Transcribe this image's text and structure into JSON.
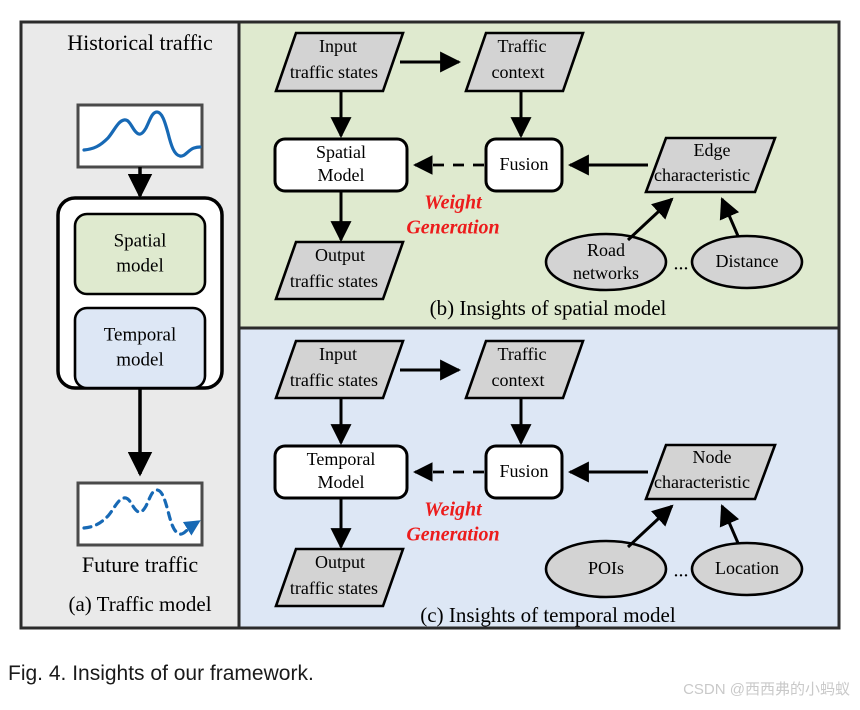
{
  "figure": {
    "caption": "Fig. 4. Insights of our framework.",
    "watermark": "CSDN @西西弗的小蚂蚁"
  },
  "colors": {
    "panel_a_bg": "#eaeaea",
    "panel_b_bg": "#dfeacf",
    "panel_c_bg": "#dde7f5",
    "node_gray_fill": "#d3d3d3",
    "node_white_fill": "#ffffff",
    "stroke": "#000000",
    "frame_stroke": "#4a4a4a",
    "chart_line": "#1769b5",
    "weight_red": "#ec1c1c"
  },
  "panel_a": {
    "title_top": "Historical traffic",
    "title_bottom": "Future traffic",
    "caption": "(a) Traffic model",
    "model_box_items": [
      {
        "label_line1": "Spatial",
        "label_line2": "model",
        "fill": "#dfeacf"
      },
      {
        "label_line1": "Temporal",
        "label_line2": "model",
        "fill": "#dde7f5"
      }
    ],
    "charts": [
      {
        "name": "historical-traffic-chart",
        "style": "solid",
        "arrow": false
      },
      {
        "name": "future-traffic-chart",
        "style": "dashed",
        "arrow": true
      }
    ]
  },
  "panel_b": {
    "caption": "(b) Insights of spatial model",
    "nodes": {
      "input": {
        "line1": "Input",
        "line2": "traffic states",
        "shape": "parallelogram",
        "fill": "#d3d3d3"
      },
      "context": {
        "line1": "Traffic",
        "line2": "context",
        "shape": "parallelogram",
        "fill": "#d3d3d3"
      },
      "model": {
        "line1": "Spatial",
        "line2": "Model",
        "shape": "rounded-rect",
        "fill": "#ffffff"
      },
      "fusion": {
        "line1": "Fusion",
        "shape": "rounded-rect",
        "fill": "#ffffff"
      },
      "characteristic": {
        "line1": "Edge",
        "line2": "characteristic",
        "shape": "parallelogram",
        "fill": "#d3d3d3"
      },
      "output": {
        "line1": "Output",
        "line2": "traffic states",
        "shape": "parallelogram",
        "fill": "#d3d3d3"
      },
      "source_left": {
        "line1": "Road",
        "line2": "networks",
        "shape": "ellipse",
        "fill": "#d3d3d3"
      },
      "source_right": {
        "line1": "Distance",
        "shape": "ellipse",
        "fill": "#d3d3d3"
      },
      "source_gap": "..."
    },
    "weight_label": {
      "line1": "Weight",
      "line2": "Generation"
    }
  },
  "panel_c": {
    "caption": "(c) Insights of temporal model",
    "nodes": {
      "input": {
        "line1": "Input",
        "line2": "traffic states",
        "shape": "parallelogram",
        "fill": "#d3d3d3"
      },
      "context": {
        "line1": "Traffic",
        "line2": "context",
        "shape": "parallelogram",
        "fill": "#d3d3d3"
      },
      "model": {
        "line1": "Temporal",
        "line2": "Model",
        "shape": "rounded-rect",
        "fill": "#ffffff"
      },
      "fusion": {
        "line1": "Fusion",
        "shape": "rounded-rect",
        "fill": "#ffffff"
      },
      "characteristic": {
        "line1": "Node",
        "line2": "characteristic",
        "shape": "parallelogram",
        "fill": "#d3d3d3"
      },
      "output": {
        "line1": "Output",
        "line2": "traffic states",
        "shape": "parallelogram",
        "fill": "#d3d3d3"
      },
      "source_left": {
        "line1": "POIs",
        "shape": "ellipse",
        "fill": "#d3d3d3"
      },
      "source_right": {
        "line1": "Location",
        "shape": "ellipse",
        "fill": "#d3d3d3"
      },
      "source_gap": "..."
    },
    "weight_label": {
      "line1": "Weight",
      "line2": "Generation"
    }
  }
}
